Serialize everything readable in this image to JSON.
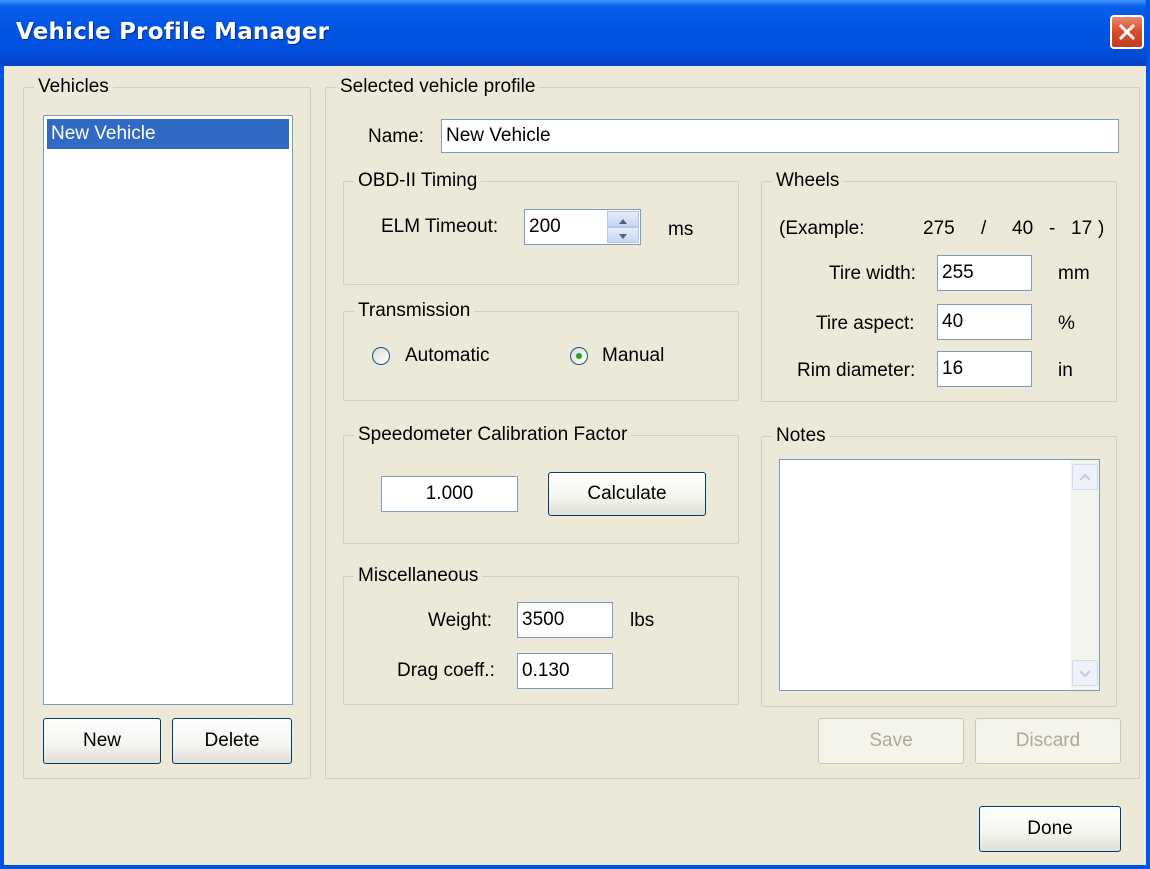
{
  "window": {
    "title": "Vehicle Profile Manager"
  },
  "vehicles": {
    "legend": "Vehicles",
    "items": [
      "New Vehicle"
    ],
    "new_label": "New",
    "delete_label": "Delete"
  },
  "profile": {
    "legend": "Selected vehicle profile",
    "name_label": "Name:",
    "name_value": "New Vehicle"
  },
  "obd": {
    "legend": "OBD-II Timing",
    "timeout_label": "ELM Timeout:",
    "timeout_value": "200",
    "timeout_unit": "ms"
  },
  "transmission": {
    "legend": "Transmission",
    "automatic_label": "Automatic",
    "manual_label": "Manual",
    "selected": "Manual"
  },
  "speedometer": {
    "legend": "Speedometer Calibration Factor",
    "value": "1.000",
    "calculate_label": "Calculate"
  },
  "misc": {
    "legend": "Miscellaneous",
    "weight_label": "Weight:",
    "weight_value": "3500",
    "weight_unit": "lbs",
    "drag_label": "Drag coeff.:",
    "drag_value": "0.130"
  },
  "wheels": {
    "legend": "Wheels",
    "example_label": "(Example:",
    "example_width": "275",
    "sep1": "/",
    "example_aspect": "40",
    "sep2": "-",
    "example_rim": "17",
    "close_paren": ")",
    "width_label": "Tire width:",
    "width_value": "255",
    "width_unit": "mm",
    "aspect_label": "Tire aspect:",
    "aspect_value": "40",
    "aspect_unit": "%",
    "rim_label": "Rim diameter:",
    "rim_value": "16",
    "rim_unit": "in"
  },
  "notes": {
    "legend": "Notes",
    "value": ""
  },
  "actions": {
    "save_label": "Save",
    "discard_label": "Discard",
    "done_label": "Done"
  }
}
